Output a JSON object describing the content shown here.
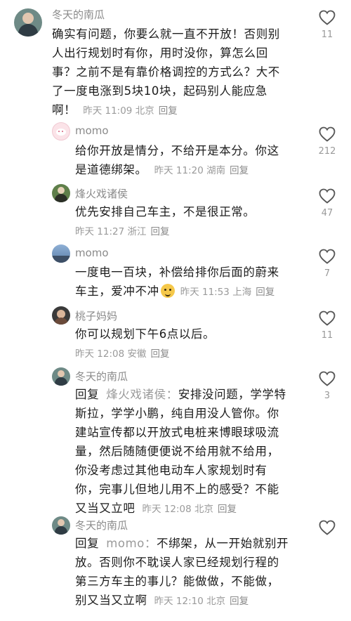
{
  "comments": [
    {
      "user": "冬天的南瓜",
      "lines": [
        "确实有问题，你要么就一直不开放！否则别",
        "人出行规划时有你，用时没你，算怎么回",
        "事？之前不是有靠价格调控的方式么？大不",
        "了一度电涨到5块10块，起码别人能应急",
        "啊！"
      ],
      "time": "昨天 11:09",
      "location": "北京",
      "reply_label": "回复",
      "likes": "11"
    },
    {
      "user": "momo",
      "lines": [
        "给你开放是情分，不给开是本分。你这",
        "是道德绑架。"
      ],
      "time": "昨天 11:20",
      "location": "湖南",
      "reply_label": "回复",
      "likes": "212"
    },
    {
      "user": "烽火戏诸侯",
      "lines": [
        "优先安排自己车主，不是很正常。"
      ],
      "time": "昨天 11:27",
      "location": "浙江",
      "reply_label": "回复",
      "likes": "47"
    },
    {
      "user": "momo",
      "lines": [
        "一度电一百块，补偿给排你后面的蔚来",
        "车主，爱冲不冲"
      ],
      "emoji": "smiling-face-emoji",
      "time": "昨天 11:53",
      "location": "上海",
      "reply_label": "回复",
      "likes": "7"
    },
    {
      "user": "桃子妈妈",
      "lines": [
        "你可以规划下午6点以后。"
      ],
      "time": "昨天 12:08",
      "location": "安徽",
      "reply_label": "回复",
      "likes": "11"
    },
    {
      "user": "冬天的南瓜",
      "reply_prefix": "回复",
      "reply_to": "烽火戏诸侯：",
      "lines": [
        "安排没问题，学学特",
        "斯拉，学学小鹏，纯自用没人管你。你",
        "建站宣传都以开放式电桩来博眼球吸流",
        "量，然后随随便便说不给用就不给用，",
        "你没考虑过其他电动车人家规划时有",
        "你，完事儿但地儿用不上的感受？不能",
        "又当又立吧"
      ],
      "time": "昨天 12:08",
      "location": "北京",
      "reply_label": "回复",
      "likes": "3"
    },
    {
      "user": "冬天的南瓜",
      "reply_prefix": "回复",
      "reply_to": "momo：",
      "lines": [
        "不绑架，从一开始就别开",
        "放。否则你不耽误人家已经规划行程的",
        "第三方车主的事儿？能做做，不能做，",
        "别又当又立啊"
      ],
      "time": "昨天 12:10",
      "location": "北京",
      "reply_label": "回复",
      "likes": ""
    }
  ],
  "colors": {
    "text": "#1c1c1c",
    "meta": "#9a9a9a",
    "heart": "#555555"
  }
}
